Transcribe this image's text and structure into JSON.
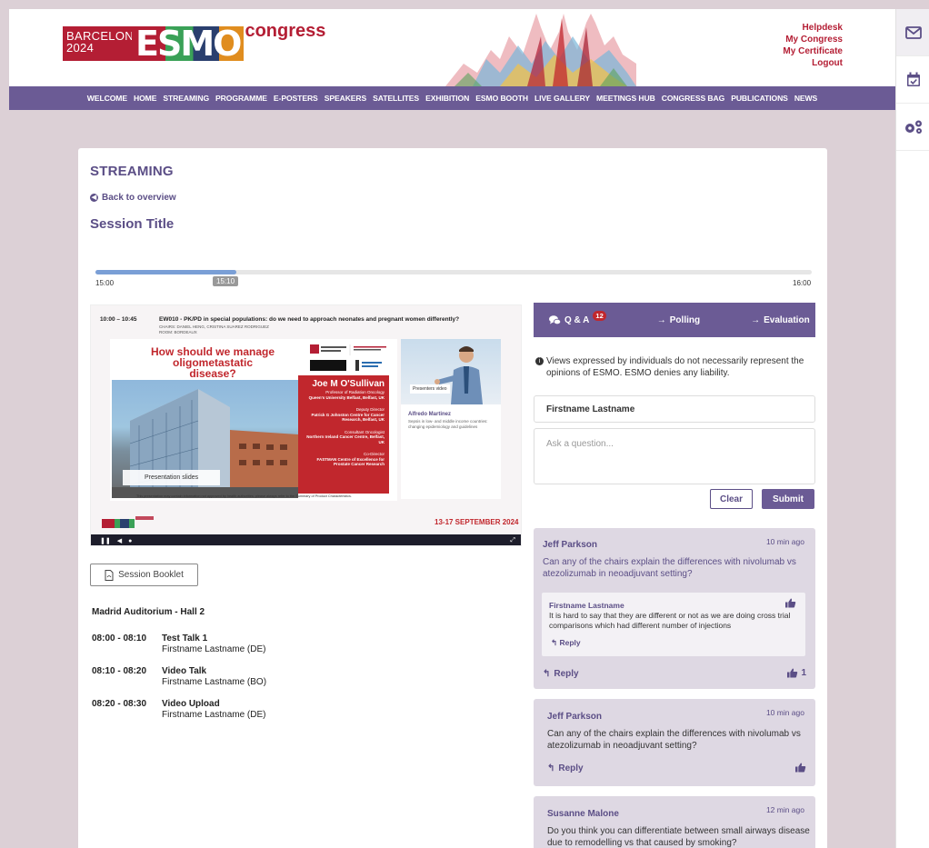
{
  "header": {
    "logo_city": "BARCELONA 2024",
    "logo_brand": "ESMO",
    "logo_congress": "congress",
    "links": [
      "Helpdesk",
      "My Congress",
      "My Certificate",
      "Logout"
    ]
  },
  "nav": [
    "WELCOME",
    "HOME",
    "STREAMING",
    "PROGRAMME",
    "E-POSTERS",
    "SPEAKERS",
    "SATELLITES",
    "EXHIBITION",
    "ESMO BOOTH",
    "LIVE GALLERY",
    "MEETINGS HUB",
    "CONGRESS BAG",
    "PUBLICATIONS",
    "NEWS"
  ],
  "rail": [
    "mail-icon",
    "calendar-check-icon",
    "settings-gears-icon"
  ],
  "page": {
    "heading": "STREAMING",
    "back": "Back to overview",
    "session_title": "Session Title"
  },
  "timeline": {
    "start": "15:00",
    "current": "15:10",
    "end": "16:00",
    "progress": 0.197
  },
  "video": {
    "time": "10:00 – 10:45",
    "title": "EW010 - PK/PD in special populations: do we need to approach neonates and pregnant women differently?",
    "chairs": "CHAIRS: DANIEL HENG, CRISTINA SUAREZ RODRIGUEZ",
    "room": "ROOM: BORDEAUX",
    "slide_question": "How should we manage oligometastatic disease?",
    "speaker_name": "Joe M O'Sullivan",
    "speaker_lines": [
      {
        "t": "Professor of Radiation Oncology",
        "b": "Queen's University Belfast, Belfast, UK"
      },
      {
        "t": "Deputy Director",
        "b": "Patrick G Johnston Centre for Cancer Research, Belfast, UK"
      },
      {
        "t": "Consultant Oncologist",
        "b": "Northern Ireland Cancer Centre, Belfast, UK"
      },
      {
        "t": "Co-Director",
        "b": "FASTMAN Centre of Excellence for Prostate Cancer Research"
      }
    ],
    "slides_label": "Presentation slides",
    "disclaimer": "This presentation may contain information not approved by health authorities; please always refer to the Summary of Product Characteristics.",
    "presenter_label": "Presenters video",
    "presenter_name": "Alfredo Martinez",
    "presenter_desc": "Sepsis in low- and middle income countries: changing epidemiology and guidelines",
    "date": "13-17 SEPTEMBER 2024"
  },
  "booklet": "Session Booklet",
  "room": "Madrid Auditorium - Hall 2",
  "talks": [
    {
      "time": "08:00 - 08:10",
      "title": "Test Talk 1",
      "speaker": "Firstname Lastname (DE)"
    },
    {
      "time": "08:10 - 08:20",
      "title": "Video Talk",
      "speaker": "Firstname Lastname (BO)"
    },
    {
      "time": "08:20 - 08:30",
      "title": "Video Upload",
      "speaker": "Firstname Lastname (DE)"
    }
  ],
  "qa": {
    "tabs": {
      "qa": "Q & A",
      "qa_count": "12",
      "polling": "Polling",
      "evaluation": "Evaluation"
    },
    "notice": "Views expressed by individuals do not necessarily represent the opinions of ESMO. ESMO denies any liability.",
    "name_value": "Firstname Lastname",
    "ask_placeholder": "Ask a question...",
    "clear": "Clear",
    "submit": "Submit",
    "reply_label": "Reply",
    "questions": [
      {
        "author": "Jeff Parkson",
        "time": "10 min ago",
        "text": "Can any of the chairs explain the differences with nivolumab vs atezolizumab in neoadjuvant setting?",
        "reply": {
          "author": "Firstname Lastname",
          "text": "It is hard to say that they are different or not as we are doing cross trial comparisons which had different number of injections"
        },
        "likes": "1"
      },
      {
        "author": "Jeff Parkson",
        "time": "10 min ago",
        "text": "Can any of the chairs explain the differences with nivolumab vs atezolizumab in neoadjuvant setting?",
        "likes": ""
      },
      {
        "author": "Susanne Malone",
        "time": "12 min ago",
        "text": "Do you think you can differentiate between small airways disease due to remodelling vs that caused by smoking?"
      }
    ]
  },
  "colors": {
    "brand_purple": "#6b5b95",
    "brand_red": "#b41e34",
    "background": "#dcd0d6"
  }
}
